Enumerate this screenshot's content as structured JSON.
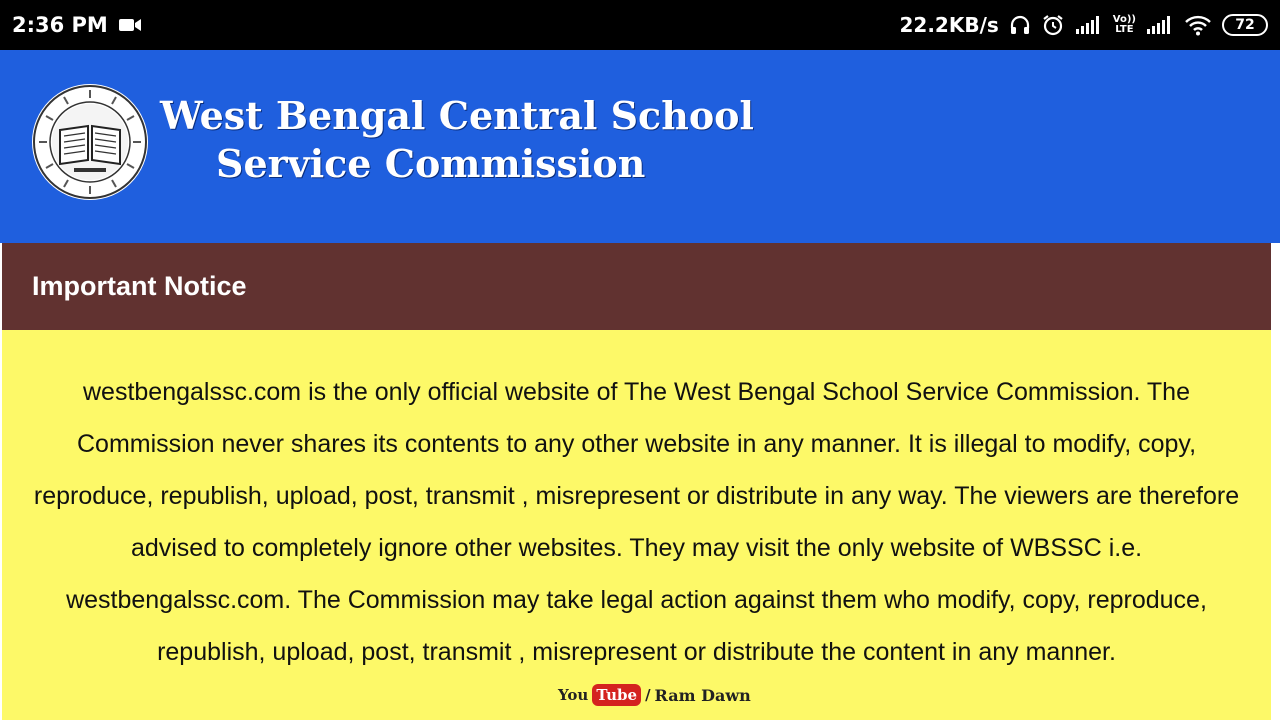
{
  "status_bar": {
    "time": "2:36 PM",
    "speed": "22.2KB/s",
    "battery": "72",
    "volte_top": "Vo))",
    "volte_bottom": "LTE",
    "icons": [
      "video-camera-icon",
      "headphones-icon",
      "alarm-icon",
      "signal-icon",
      "volte-icon",
      "signal-icon",
      "wifi-icon",
      "battery-icon"
    ]
  },
  "header": {
    "title_line1": "West Bengal Central School",
    "title_line2": "Service Commission",
    "logo_icon": "wbssc-seal-book-icon"
  },
  "notice": {
    "title": "Important Notice",
    "body": "westbengalssc.com is the only official website of The West Bengal School Service Commission. The Commission never shares its contents to any other website in any manner. It is illegal to modify, copy, reproduce, republish, upload, post, transmit , misrepresent or distribute in any way. The viewers are therefore advised to completely ignore other websites. They may visit the only website of WBSSC i.e. westbengalssc.com. The Commission may take legal action against them who modify, copy, reproduce, republish, upload, post, transmit , misrepresent or distribute the content in any manner."
  },
  "watermark": {
    "you": "You",
    "tube": "Tube",
    "sep": "/",
    "channel": "Ram Dawn"
  },
  "colors": {
    "status_bar_bg": "#000000",
    "banner_bg": "#1f5fde",
    "notice_header_bg": "#613230",
    "notice_body_bg": "#fdf968"
  }
}
